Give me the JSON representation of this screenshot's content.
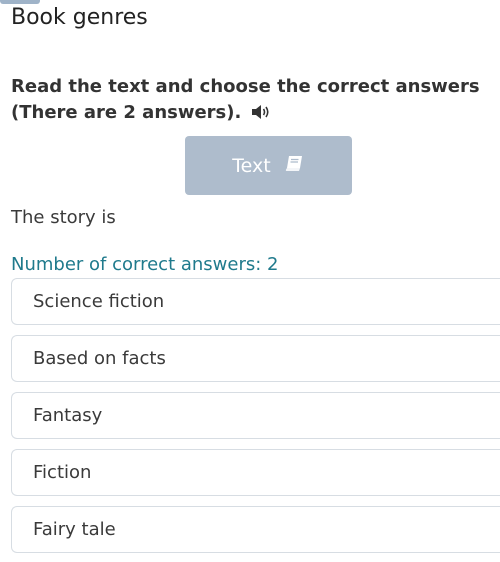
{
  "header": {
    "title": "Book genres"
  },
  "task": {
    "instruction": "Read the text and choose the correct answers (There are 2 answers).",
    "audio_icon": "speaker-icon",
    "text_button_label": "Text",
    "text_button_icon": "book-icon",
    "question": "The story is",
    "correct_count_label": "Number of correct answers: 2"
  },
  "options": [
    {
      "label": "Science fiction"
    },
    {
      "label": "Based on facts"
    },
    {
      "label": "Fantasy"
    },
    {
      "label": "Fiction"
    },
    {
      "label": "Fairy tale"
    }
  ],
  "colors": {
    "accent_teal": "#1f7a8c",
    "button_bg": "#aebccc",
    "option_border": "#d7dde3"
  }
}
